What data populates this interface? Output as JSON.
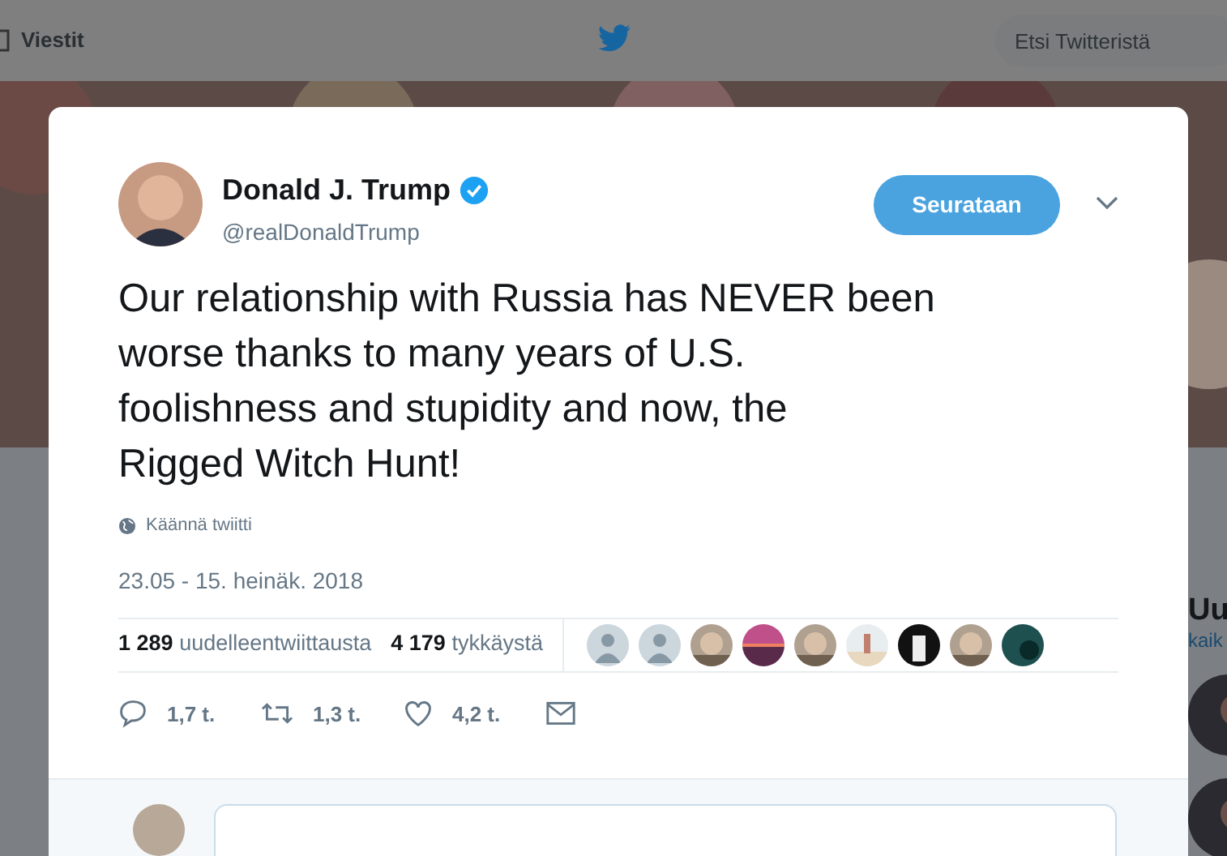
{
  "top_bar": {
    "messages_label": "Viestit",
    "search": {
      "placeholder": "Etsi Twitteristä"
    }
  },
  "sidebar": {
    "title": "Uu",
    "link": "kaik"
  },
  "tweet": {
    "name": "Donald J. Trump",
    "verified": true,
    "handle": "@realDonaldTrump",
    "follow_button": "Seurataan",
    "text_lines": [
      "Our relationship with Russia has NEVER been",
      "worse thanks to many years of U.S.",
      "foolishness and stupidity and now, the",
      "Rigged Witch Hunt!"
    ],
    "translate": "Käännä twiitti",
    "timestamp": "23.05 - 15. heinäk. 2018",
    "stats": [
      {
        "count": "1 289",
        "label": "uudelleentwiittausta"
      },
      {
        "count": "4 179",
        "label": "tykkäystä"
      }
    ],
    "liked_by": [
      {
        "kind": "default"
      },
      {
        "kind": "default"
      },
      {
        "kind": "picture"
      },
      {
        "kind": "sunset"
      },
      {
        "kind": "picture"
      },
      {
        "kind": "beach"
      },
      {
        "kind": "dark"
      },
      {
        "kind": "picture"
      },
      {
        "kind": "teal"
      }
    ],
    "actions": [
      {
        "kind": "reply",
        "count": "1,7 t."
      },
      {
        "kind": "retweet",
        "count": "1,3 t."
      },
      {
        "kind": "like",
        "count": "4,2 t."
      },
      {
        "kind": "message"
      }
    ]
  }
}
